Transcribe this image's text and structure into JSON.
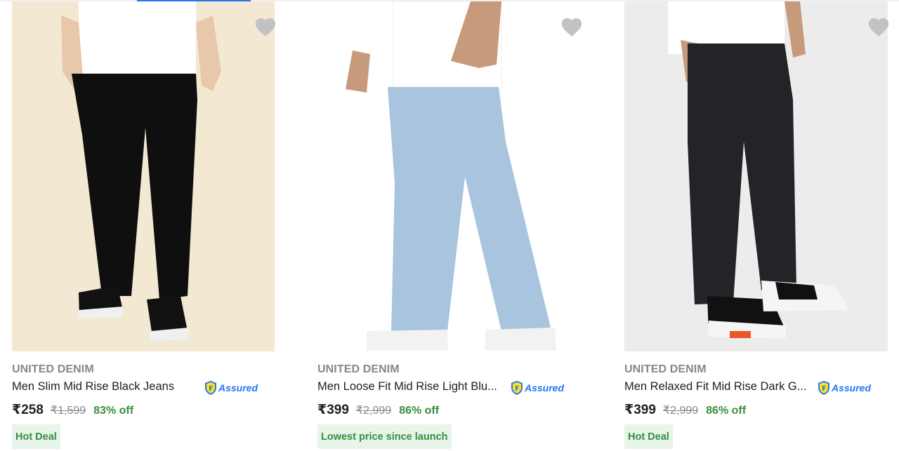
{
  "products": [
    {
      "brand": "UNITED DENIM",
      "title": "Men Slim Mid Rise Black Jeans",
      "assured": "Assured",
      "price": "₹258",
      "mrp": "₹1,599",
      "discount": "83% off",
      "deal": "Hot Deal",
      "image_background": "#f3e8d2",
      "jeans_color": "#0f0f10"
    },
    {
      "brand": "UNITED DENIM",
      "title": "Men Loose Fit Mid Rise Light Blu...",
      "assured": "Assured",
      "price": "₹399",
      "mrp": "₹2,999",
      "discount": "86% off",
      "deal": "Lowest price since launch",
      "image_background": "#ffffff",
      "jeans_color": "#a8c4de"
    },
    {
      "brand": "UNITED DENIM",
      "title": "Men Relaxed Fit Mid Rise Dark G...",
      "assured": "Assured",
      "price": "₹399",
      "mrp": "₹2,999",
      "discount": "86% off",
      "deal": "Hot Deal",
      "image_background": "#ececec",
      "jeans_color": "#232428"
    }
  ],
  "icons": {
    "wishlist": "heart-icon",
    "assured": "assured-badge-icon"
  },
  "colors": {
    "accent": "#2874f0",
    "discount": "#388e3c",
    "deal_bg": "#e6f4ea",
    "muted": "#878787"
  }
}
